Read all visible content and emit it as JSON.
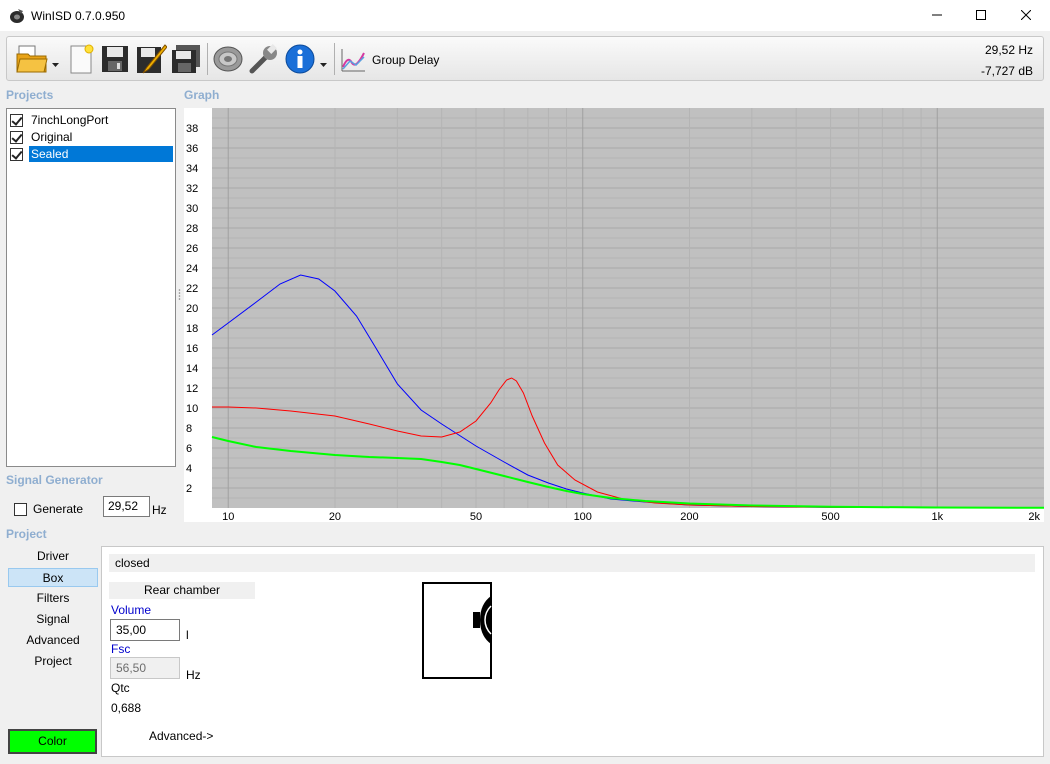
{
  "window": {
    "title": "WinISD 0.7.0.950"
  },
  "toolbar": {
    "group_delay_label": "Group Delay",
    "readout_freq": "29,52 Hz",
    "readout_level": "-7,727 dB",
    "icons": [
      "open-folder-icon",
      "new-document-icon",
      "save-icon",
      "edit-icon",
      "save-all-icon",
      "driver-icon",
      "wrench-icon",
      "info-icon",
      "group-delay-icon"
    ]
  },
  "projects": {
    "heading": "Projects",
    "items": [
      {
        "label": "7inchLongPort",
        "checked": true
      },
      {
        "label": "Original",
        "checked": true
      },
      {
        "label": "Sealed",
        "checked": true,
        "selected": true
      }
    ]
  },
  "graph": {
    "heading": "Graph",
    "background": "#c0c0c0"
  },
  "signal_generator": {
    "heading": "Signal Generator",
    "generate_label": "Generate",
    "frequency_value": "29,52",
    "frequency_unit": "Hz"
  },
  "project_nav": {
    "heading": "Project",
    "items": [
      "Driver",
      "Box",
      "Filters",
      "Signal",
      "Advanced",
      "Project"
    ],
    "active": "Box",
    "color_button": "Color",
    "color_value": "#00ff00"
  },
  "box": {
    "type": "closed",
    "rear_chamber_label": "Rear chamber",
    "volume_label": "Volume",
    "volume_value": "35,00",
    "volume_unit": "l",
    "fsc_label": "Fsc",
    "fsc_value": "56,50",
    "fsc_unit": "Hz",
    "qtc_label": "Qtc",
    "qtc_value": "0,688",
    "advanced_link": "Advanced->"
  },
  "chart_data": {
    "type": "line",
    "x_scale": "log",
    "xlim": [
      9,
      2000
    ],
    "ylim": [
      0,
      40
    ],
    "grid": true,
    "x_ticks": [
      10,
      20,
      50,
      100,
      200,
      500,
      1000,
      2000
    ],
    "x_tick_labels": [
      "10",
      "20",
      "50",
      "100",
      "200",
      "500",
      "1k",
      "2k"
    ],
    "y_ticks": [
      2,
      4,
      6,
      8,
      10,
      12,
      14,
      16,
      18,
      20,
      22,
      24,
      26,
      28,
      30,
      32,
      34,
      36,
      38
    ],
    "series": [
      {
        "color": "#0000ff",
        "points": [
          [
            9,
            17.3
          ],
          [
            10,
            18.5
          ],
          [
            12,
            20.6
          ],
          [
            14,
            22.4
          ],
          [
            16,
            23.3
          ],
          [
            18,
            22.9
          ],
          [
            20,
            21.7
          ],
          [
            23,
            19.2
          ],
          [
            26,
            16.1
          ],
          [
            30,
            12.4
          ],
          [
            35,
            9.8
          ],
          [
            40,
            8.4
          ],
          [
            50,
            6.2
          ],
          [
            60,
            4.6
          ],
          [
            70,
            3.3
          ],
          [
            80,
            2.5
          ],
          [
            90,
            1.9
          ],
          [
            100,
            1.5
          ],
          [
            120,
            0.9
          ],
          [
            150,
            0.6
          ],
          [
            200,
            0.3
          ],
          [
            300,
            0.15
          ],
          [
            500,
            0.08
          ],
          [
            1000,
            0.04
          ],
          [
            2000,
            0.02
          ]
        ]
      },
      {
        "color": "#ff0000",
        "points": [
          [
            9,
            10.1
          ],
          [
            10,
            10.1
          ],
          [
            12,
            10.0
          ],
          [
            15,
            9.7
          ],
          [
            20,
            9.2
          ],
          [
            25,
            8.4
          ],
          [
            30,
            7.7
          ],
          [
            35,
            7.2
          ],
          [
            40,
            7.1
          ],
          [
            45,
            7.6
          ],
          [
            50,
            8.7
          ],
          [
            55,
            10.5
          ],
          [
            58,
            11.8
          ],
          [
            61,
            12.8
          ],
          [
            63,
            13.0
          ],
          [
            65,
            12.7
          ],
          [
            68,
            11.5
          ],
          [
            72,
            9.2
          ],
          [
            78,
            6.5
          ],
          [
            85,
            4.3
          ],
          [
            95,
            2.8
          ],
          [
            110,
            1.6
          ],
          [
            130,
            0.9
          ],
          [
            160,
            0.5
          ],
          [
            200,
            0.3
          ],
          [
            300,
            0.15
          ],
          [
            500,
            0.08
          ],
          [
            1000,
            0.04
          ],
          [
            2000,
            0.02
          ]
        ]
      },
      {
        "color": "#00ff00",
        "points": [
          [
            9,
            7.1
          ],
          [
            10,
            6.7
          ],
          [
            12,
            6.1
          ],
          [
            15,
            5.7
          ],
          [
            20,
            5.3
          ],
          [
            25,
            5.1
          ],
          [
            30,
            5.0
          ],
          [
            35,
            4.9
          ],
          [
            40,
            4.6
          ],
          [
            45,
            4.3
          ],
          [
            50,
            3.9
          ],
          [
            60,
            3.2
          ],
          [
            70,
            2.6
          ],
          [
            80,
            2.1
          ],
          [
            90,
            1.7
          ],
          [
            100,
            1.4
          ],
          [
            120,
            1.0
          ],
          [
            150,
            0.7
          ],
          [
            200,
            0.45
          ],
          [
            300,
            0.25
          ],
          [
            500,
            0.12
          ],
          [
            1000,
            0.05
          ],
          [
            2000,
            0.02
          ]
        ]
      }
    ]
  }
}
